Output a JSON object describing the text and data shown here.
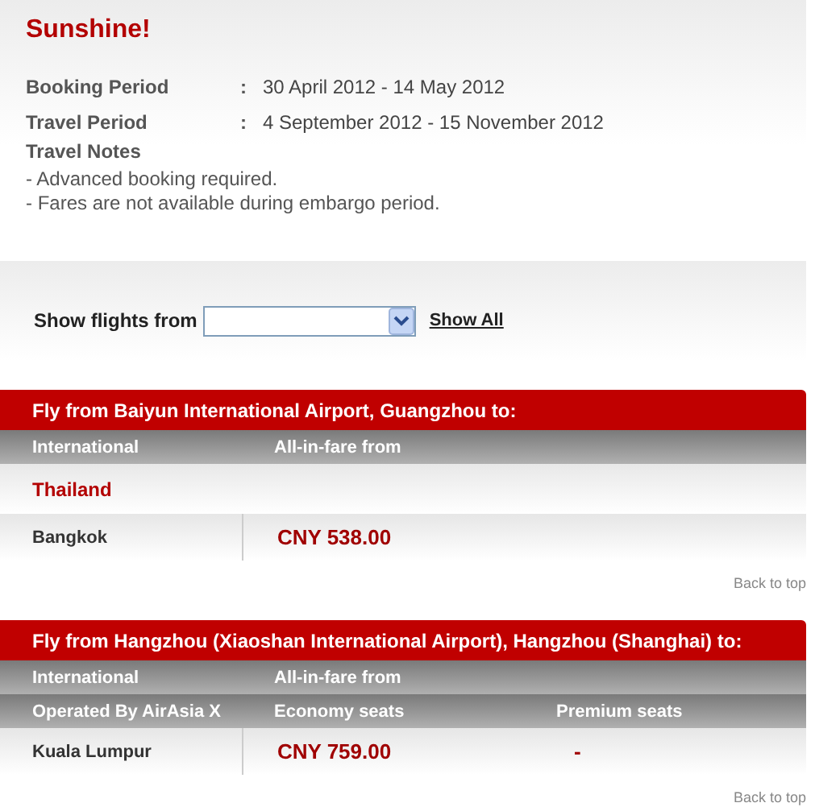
{
  "promo": {
    "title": "Sunshine!",
    "periods": [
      {
        "label": "Booking Period",
        "separator": ":",
        "value": "30 April 2012 - 14 May 2012"
      },
      {
        "label": "Travel Period",
        "separator": ":",
        "value": "4 September 2012 - 15 November 2012"
      }
    ],
    "notes_title": "Travel Notes",
    "notes": [
      "- Advanced booking required.",
      "- Fares are not available during embargo period."
    ]
  },
  "filter": {
    "label": "Show flights from",
    "link": "Show All"
  },
  "sections": [
    {
      "title": "Fly from Baiyun International Airport, Guangzhou to:",
      "header_rows": [
        [
          "International",
          "All-in-fare from"
        ]
      ],
      "rows": [
        {
          "kind": "country",
          "label": "Thailand"
        },
        {
          "kind": "route",
          "cells": [
            "Bangkok",
            "CNY 538.00"
          ]
        }
      ],
      "back_link": "Back to top"
    },
    {
      "title": "Fly from Hangzhou (Xiaoshan International Airport), Hangzhou (Shanghai) to:",
      "header_rows": [
        [
          "International",
          "All-in-fare from"
        ],
        [
          "Operated By AirAsia X",
          "Economy seats",
          "Premium seats"
        ]
      ],
      "rows": [
        {
          "kind": "route",
          "cells": [
            "Kuala Lumpur",
            "CNY 759.00",
            "-"
          ]
        }
      ],
      "back_link": "Back to top"
    }
  ]
}
